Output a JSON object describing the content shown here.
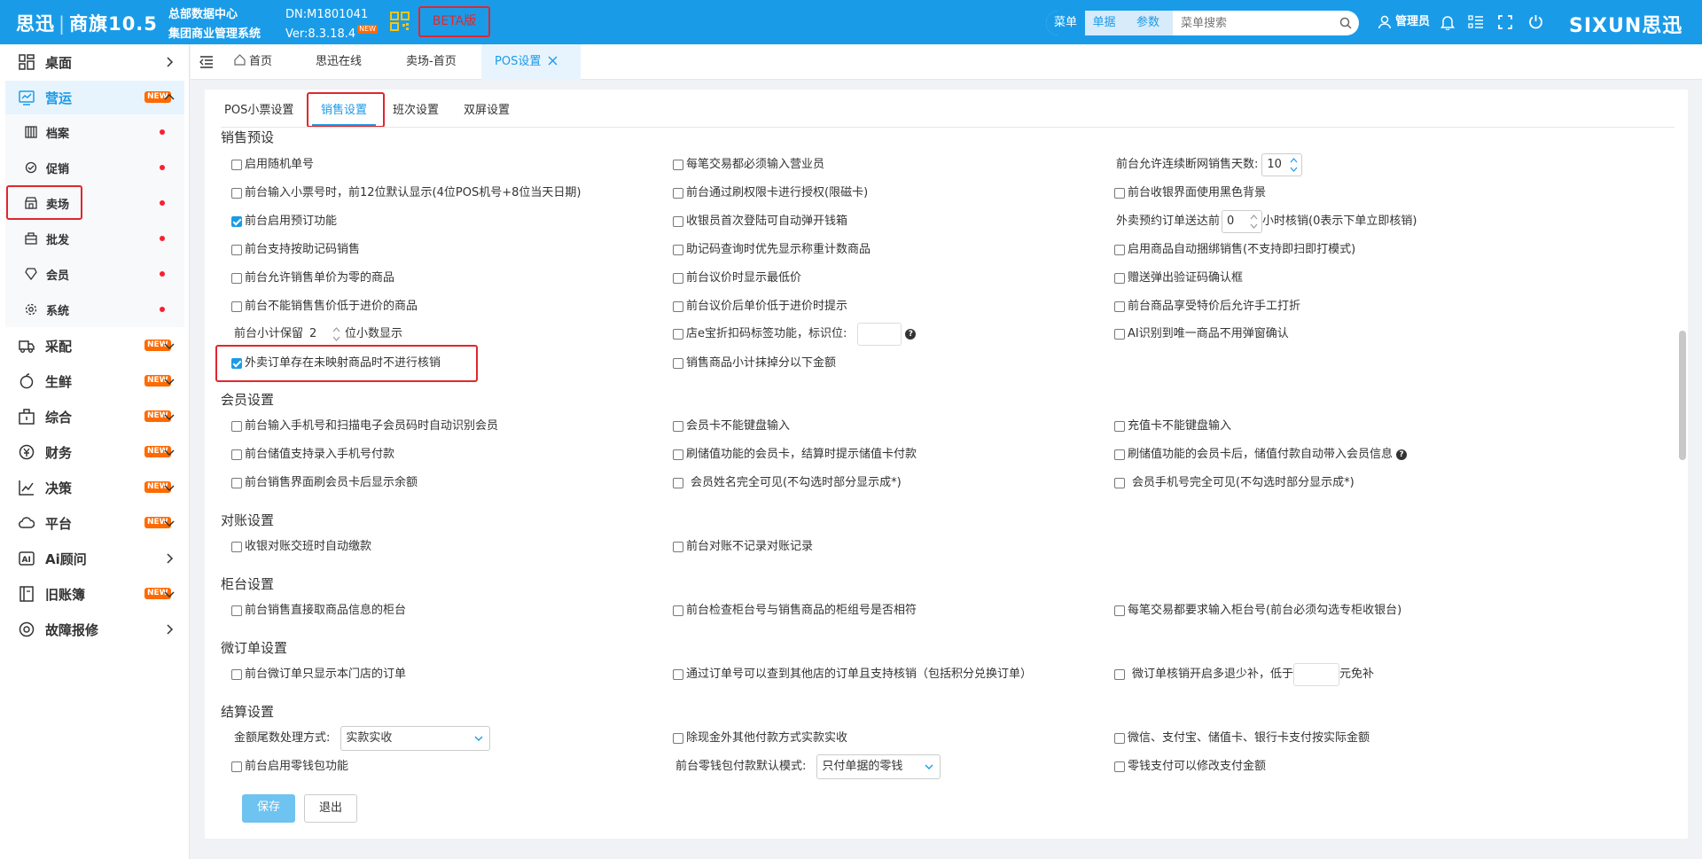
{
  "header": {
    "logo": "思迅",
    "product": "商旗10.5",
    "org_name": "总部数据中心",
    "system_name": "集团商业管理系统",
    "dn": "DN:M1801041",
    "version": "Ver:8.3.18.4",
    "new_badge": "NEW",
    "beta": "BETA版",
    "search_modes": [
      "菜单",
      "单据",
      "参数"
    ],
    "search_placeholder": "菜单搜索",
    "user": "管理员",
    "brand": "SIXUN思迅"
  },
  "sidebar": {
    "new_badge": "NEW",
    "items": [
      {
        "label": "桌面",
        "icon": "desktop-icon"
      },
      {
        "label": "营运",
        "icon": "operations-icon"
      },
      {
        "label": "采配",
        "icon": "purchase-icon"
      },
      {
        "label": "生鲜",
        "icon": "fresh-icon"
      },
      {
        "label": "综合",
        "icon": "general-icon"
      },
      {
        "label": "财务",
        "icon": "finance-icon"
      },
      {
        "label": "决策",
        "icon": "decision-icon"
      },
      {
        "label": "平台",
        "icon": "cloud-icon"
      },
      {
        "label": "Ai顾问",
        "icon": "ai-icon"
      },
      {
        "label": "旧账簿",
        "icon": "ledger-icon"
      },
      {
        "label": "故障报修",
        "icon": "repair-icon"
      }
    ],
    "sub_items": [
      {
        "label": "档案"
      },
      {
        "label": "促销"
      },
      {
        "label": "卖场"
      },
      {
        "label": "批发"
      },
      {
        "label": "会员"
      },
      {
        "label": "系统"
      }
    ]
  },
  "tabs": [
    "首页",
    "思迅在线",
    "卖场-首页",
    "POS设置"
  ],
  "subtabs": [
    "POS小票设置",
    "销售设置",
    "班次设置",
    "双屏设置"
  ],
  "sections": {
    "sales": {
      "title": "销售预设",
      "rows": [
        [
          "启用随机单号",
          "每笔交易都必须输入营业员",
          "前台允许连续断网销售天数:"
        ],
        [
          "前台输入小票号时，前12位默认显示(4位POS机号+8位当天日期)",
          "前台通过刷权限卡进行授权(限磁卡)",
          "前台收银界面使用黑色背景"
        ],
        [
          "前台启用预订功能",
          "收银员首次登陆可自动弹开钱箱",
          "外卖预约订单送达前"
        ],
        [
          "前台支持按助记码销售",
          "助记码查询时优先显示称重计数商品",
          "启用商品自动捆绑销售(不支持即扫即打模式)"
        ],
        [
          "前台允许销售单价为零的商品",
          "前台议价时显示最低价",
          "赠送弹出验证码确认框"
        ],
        [
          "前台不能销售售价低于进价的商品",
          "前台议价后单价低于进价时提示",
          "前台商品享受特价后允许手工打折"
        ],
        [
          "前台小计保留",
          "店e宝折扣码标签功能，标识位:",
          "AI识别到唯一商品不用弹窗确认"
        ],
        [
          "外卖订单存在未映射商品时不进行核销",
          "销售商品小计抹掉分以下金额"
        ]
      ],
      "offline_days": "10",
      "delivery_hours": "0",
      "delivery_suffix": "小时核销(0表示下单立即核销)",
      "decimal_places": "2",
      "decimal_suffix": "位小数显示"
    },
    "member": {
      "title": "会员设置",
      "rows": [
        [
          "前台输入手机号和扫描电子会员码时自动识别会员",
          "会员卡不能键盘输入",
          "充值卡不能键盘输入"
        ],
        [
          "前台储值支持录入手机号付款",
          "刷储值功能的会员卡，结算时提示储值卡付款",
          "刷储值功能的会员卡后，储值付款自动带入会员信息"
        ],
        [
          "前台销售界面刷会员卡后显示余额",
          "会员姓名完全可见(不勾选时部分显示成*)",
          "会员手机号完全可见(不勾选时部分显示成*)"
        ]
      ]
    },
    "reconcile": {
      "title": "对账设置",
      "rows": [
        [
          "收银对账交班时自动缴款",
          "前台对账不记录对账记录"
        ]
      ]
    },
    "counter": {
      "title": "柜台设置",
      "rows": [
        [
          "前台销售直接取商品信息的柜台",
          "前台检查柜台号与销售商品的柜组号是否相符",
          "每笔交易都要求输入柜台号(前台必须勾选专柜收银台)"
        ]
      ]
    },
    "micro": {
      "title": "微订单设置",
      "rows": [
        [
          "前台微订单只显示本门店的订单",
          "通过订单号可以查到其他店的订单且支持核销（包括积分兑换订单）",
          "微订单核销开启多退少补，低于"
        ]
      ],
      "suffix": "元免补"
    },
    "settle": {
      "title": "结算设置",
      "rounding_label": "金额尾数处理方式:",
      "rounding_value": "实款实收",
      "row1": [
        "除现金外其他付款方式实款实收",
        "微信、支付宝、储值卡、银行卡支付按实际金额"
      ],
      "row2": [
        "前台启用零钱包功能",
        "零钱支付可以修改支付金额"
      ],
      "wallet_label": "前台零钱包付款默认模式:",
      "wallet_value": "只付单据的零钱"
    }
  },
  "buttons": {
    "save": "保存",
    "exit": "退出"
  },
  "colors": {
    "primary": "#1a9be8",
    "highlight": "#e0272d",
    "badge": "#ff6a00"
  }
}
